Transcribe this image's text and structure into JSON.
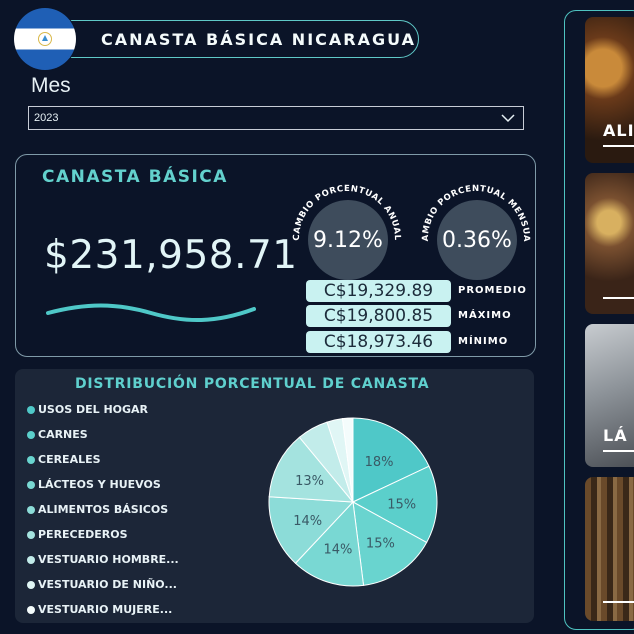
{
  "header": {
    "title": "CANASTA BÁSICA NICARAGUA",
    "flag_icon": "nicaragua-flag-icon"
  },
  "filter": {
    "label": "Mes",
    "selected": "2023"
  },
  "canasta": {
    "title": "CANASTA BÁSICA",
    "total": "$231,958.71",
    "annual_label": "CAMBIO PORCENTUAL ANUAL",
    "annual_value": "9.12%",
    "monthly_label": "CAMBIO PORCENTUAL MENSUAL",
    "monthly_value": "0.36%",
    "stats": [
      {
        "value": "C$19,329.89",
        "label": "PROMEDIO"
      },
      {
        "value": "C$19,800.85",
        "label": "MÁXIMO"
      },
      {
        "value": "C$18,973.46",
        "label": "MÍNIMO"
      }
    ]
  },
  "distribution": {
    "title": "DISTRIBUCIÓN PORCENTUAL DE CANASTA",
    "legend": [
      {
        "label": "USOS DEL HOGAR",
        "color": "#4fc8c8"
      },
      {
        "label": "CARNES",
        "color": "#5bcfcb"
      },
      {
        "label": "CEREALES",
        "color": "#69d4cf"
      },
      {
        "label": "LÁCTEOS Y HUEVOS",
        "color": "#79d8d3"
      },
      {
        "label": "ALIMENTOS BÁSICOS",
        "color": "#8cdcd8"
      },
      {
        "label": "PERECEDEROS",
        "color": "#a4e3df"
      },
      {
        "label": "VESTUARIO HOMBRE...",
        "color": "#c2ecea"
      },
      {
        "label": "VESTUARIO DE NIÑO...",
        "color": "#e0f6f5"
      },
      {
        "label": "VESTUARIO MUJERE...",
        "color": "#f4fcfc"
      }
    ]
  },
  "chart_data": {
    "type": "pie",
    "title": "DISTRIBUCIÓN PORCENTUAL DE CANASTA",
    "categories": [
      "USOS DEL HOGAR",
      "CARNES",
      "CEREALES",
      "LÁCTEOS Y HUEVOS",
      "ALIMENTOS BÁSICOS",
      "PERECEDEROS",
      "VESTUARIO HOMBRE...",
      "VESTUARIO DE NIÑO...",
      "VESTUARIO MUJERE..."
    ],
    "values": [
      18,
      15,
      15,
      14,
      14,
      13,
      6,
      3,
      2
    ],
    "data_labels": [
      "18%",
      "15%",
      "15%",
      "14%",
      "14%",
      "13%",
      "",
      "",
      ""
    ],
    "colors": [
      "#4fc8c8",
      "#5bcfcb",
      "#69d4cf",
      "#79d8d3",
      "#8cdcd8",
      "#a4e3df",
      "#c2ecea",
      "#e0f6f5",
      "#f4fcfc"
    ],
    "legend": "left"
  },
  "side_panels": [
    {
      "caption": "ALI",
      "icon": "food-photo"
    },
    {
      "caption": "",
      "icon": "vegetables-photo"
    },
    {
      "caption": "LÁ",
      "icon": "dairy-photo"
    },
    {
      "caption": "",
      "icon": "clothing-photo"
    }
  ]
}
